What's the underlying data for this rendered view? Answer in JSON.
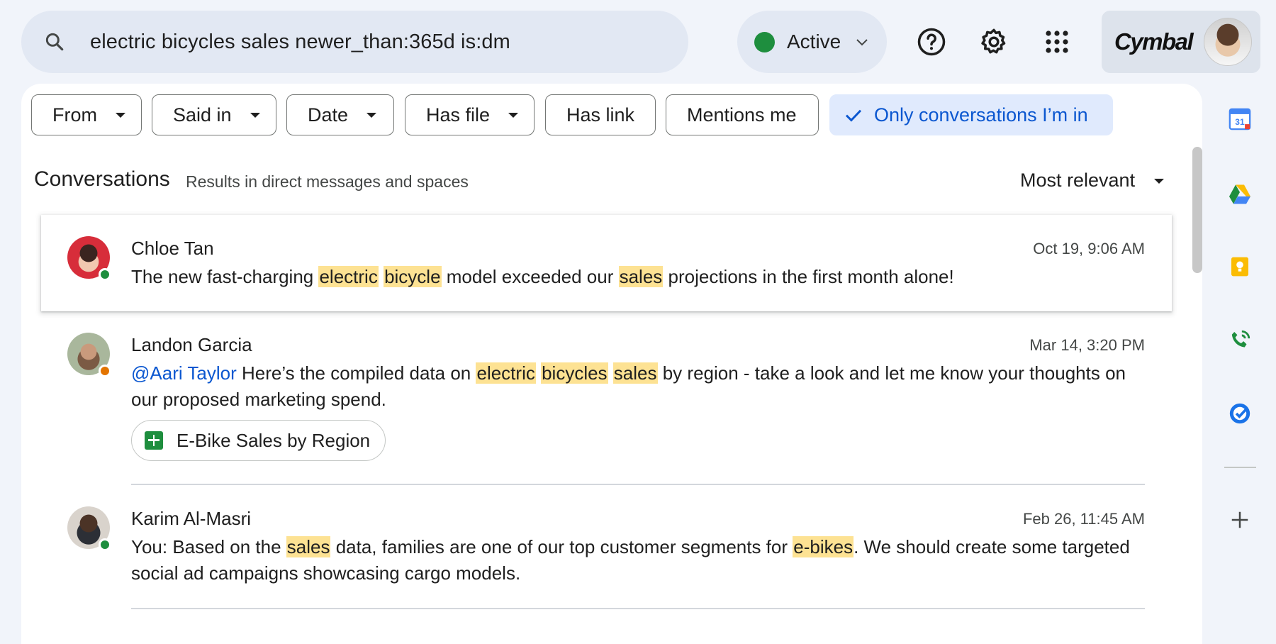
{
  "search": {
    "query": "electric bicycles sales newer_than:365d is:dm"
  },
  "status": {
    "label": "Active",
    "color": "#1e8e3e"
  },
  "header_icons": [
    "help-icon",
    "settings-gear-icon",
    "apps-grid-icon"
  ],
  "brand": {
    "name": "Cymbal"
  },
  "filters": [
    {
      "label": "From",
      "dropdown": true
    },
    {
      "label": "Said in",
      "dropdown": true
    },
    {
      "label": "Date",
      "dropdown": true
    },
    {
      "label": "Has file",
      "dropdown": true
    },
    {
      "label": "Has link",
      "dropdown": false
    },
    {
      "label": "Mentions me",
      "dropdown": false
    },
    {
      "label": "Only conversations I’m in",
      "dropdown": false,
      "selected": true
    }
  ],
  "conversations": {
    "title": "Conversations",
    "subtitle": "Results in direct messages and spaces",
    "sort": "Most relevant"
  },
  "results": [
    {
      "sender": "Chloe Tan",
      "time": "Oct 19, 9:06 AM",
      "presence": "online",
      "message": [
        {
          "t": "The new fast-charging "
        },
        {
          "t": "electric",
          "hl": true
        },
        {
          "t": " "
        },
        {
          "t": "bicycle",
          "hl": true
        },
        {
          "t": " model exceeded our "
        },
        {
          "t": "sales",
          "hl": true
        },
        {
          "t": " projections in the first month alone!"
        }
      ]
    },
    {
      "sender": "Landon Garcia",
      "time": "Mar 14, 3:20 PM",
      "presence": "away",
      "message": [
        {
          "t": "@Aari Taylor",
          "mention": true
        },
        {
          "t": " Here’s the compiled data on "
        },
        {
          "t": "electric",
          "hl": true
        },
        {
          "t": " "
        },
        {
          "t": "bicycles",
          "hl": true
        },
        {
          "t": " "
        },
        {
          "t": "sales",
          "hl": true
        },
        {
          "t": " by region - take a look and let me know your thoughts on our proposed marketing spend."
        }
      ],
      "attachment": "E-Bike Sales by Region"
    },
    {
      "sender": "Karim Al-Masri",
      "time": "Feb 26, 11:45 AM",
      "presence": "online",
      "message": [
        {
          "t": "You: Based on the "
        },
        {
          "t": "sales",
          "hl": true
        },
        {
          "t": " data, families are one of our top customer segments for "
        },
        {
          "t": "e-bikes",
          "hl": true
        },
        {
          "t": ". We should create some targeted social ad campaigns showcasing cargo models."
        }
      ]
    }
  ],
  "rail": {
    "calendar_day": "31",
    "icons": [
      "calendar-icon",
      "drive-icon",
      "keep-icon",
      "voice-icon",
      "tasks-icon",
      "add-icon"
    ]
  }
}
